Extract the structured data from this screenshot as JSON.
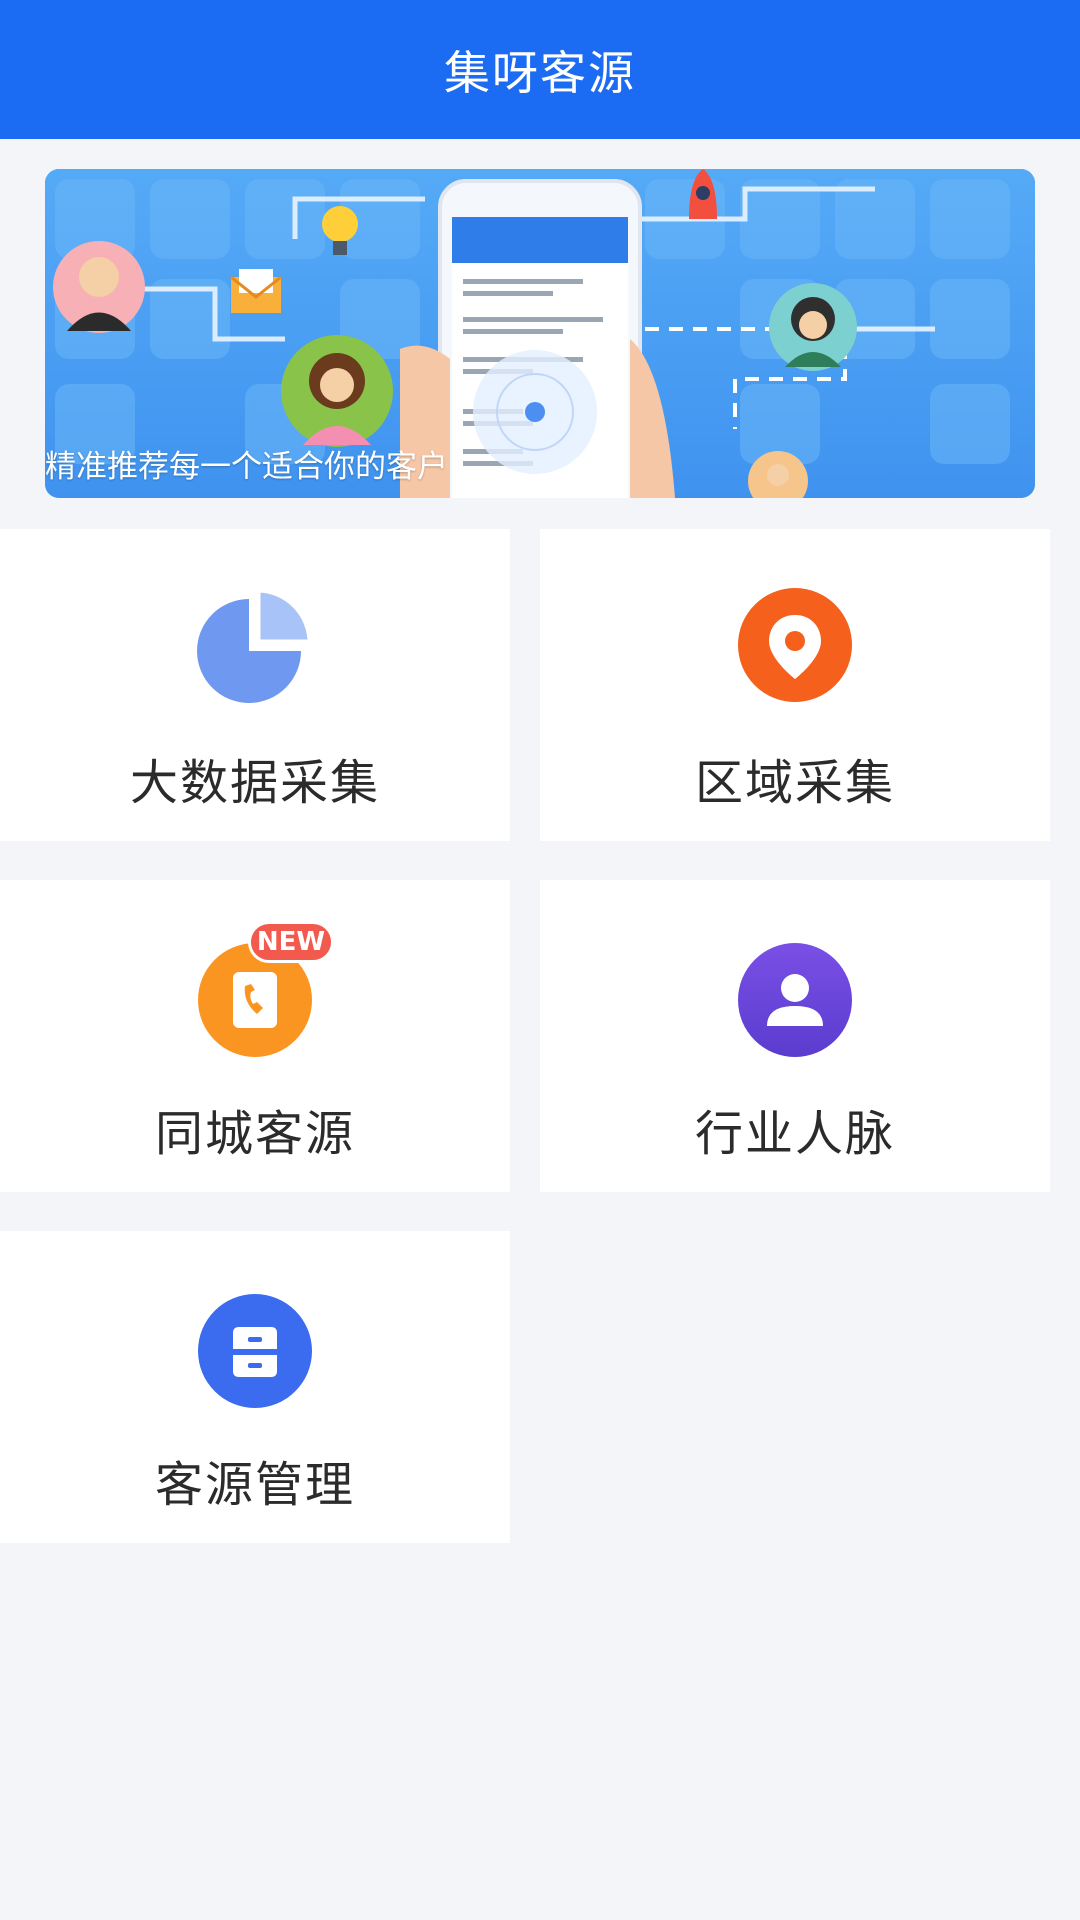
{
  "header": {
    "title": "集呀客源"
  },
  "banner": {
    "caption": "精准推荐每一个适合你的客户"
  },
  "grid": {
    "items": [
      {
        "label": "大数据采集",
        "icon": "pie-chart-icon",
        "color": "#6f98f0"
      },
      {
        "label": "区域采集",
        "icon": "location-pin-icon",
        "color": "#f5601c"
      },
      {
        "label": "同城客源",
        "icon": "phone-book-icon",
        "color": "#fb9522",
        "badge": "NEW"
      },
      {
        "label": "行业人脉",
        "icon": "person-icon",
        "color": "#6a45dd"
      },
      {
        "label": "客源管理",
        "icon": "drawer-icon",
        "color": "#3b6cf0"
      }
    ]
  }
}
